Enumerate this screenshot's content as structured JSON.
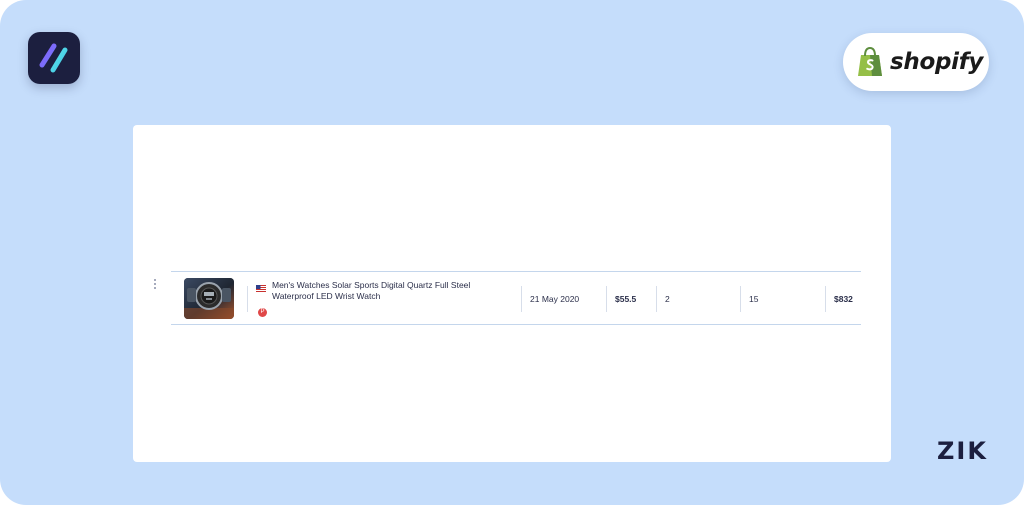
{
  "brand": {
    "app_logo_icon": "slash-stripes-logo-icon",
    "shopify_text": "shopify",
    "zik_text": "ZIK",
    "colors": {
      "background": "#c5ddfb",
      "app_logo_bg": "#1c1f3f",
      "shopify_green": "#95bf47",
      "zik": "#1c1f3f"
    }
  },
  "product_row": {
    "flag_icon": "us-flag-icon",
    "title": "Men's Watches Solar Sports Digital Quartz Full Steel Waterproof LED Wrist Watch",
    "date": "21 May 2020",
    "price": "$55.5",
    "col_a": "2",
    "col_b": "15",
    "revenue": "$832"
  }
}
